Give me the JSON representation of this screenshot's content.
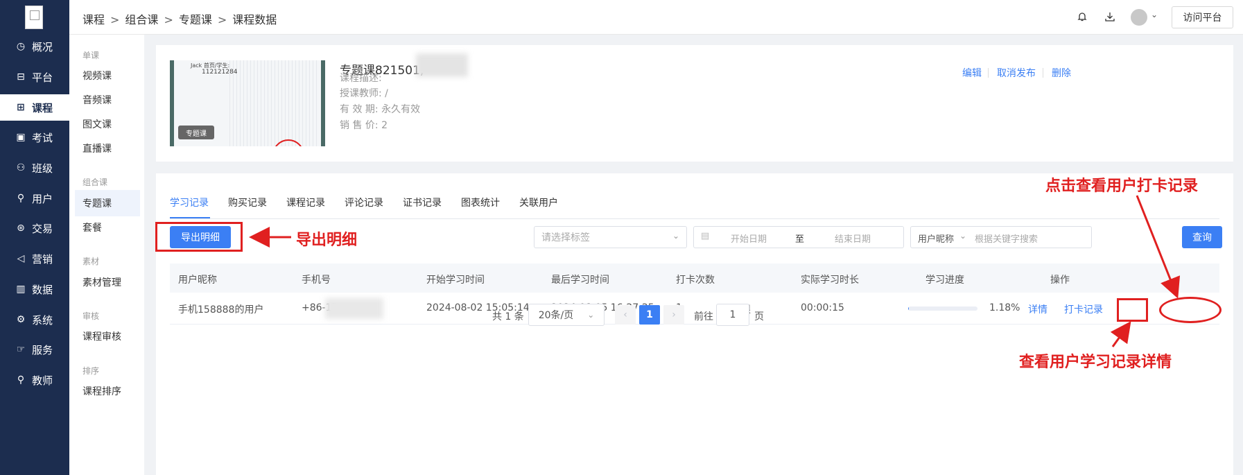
{
  "breadcrumb": [
    "课程",
    "组合课",
    "专题课",
    "课程数据"
  ],
  "header": {
    "visit_label": "访问平台"
  },
  "left_nav": [
    {
      "label": "概况",
      "icon": "◷",
      "icon_name": "overview-icon"
    },
    {
      "label": "平台",
      "icon": "⊟",
      "icon_name": "platform-icon"
    },
    {
      "label": "课程",
      "icon": "⊞",
      "icon_name": "course-icon"
    },
    {
      "label": "考试",
      "icon": "▣",
      "icon_name": "exam-icon"
    },
    {
      "label": "班级",
      "icon": "⚇",
      "icon_name": "class-icon"
    },
    {
      "label": "用户",
      "icon": "⚲",
      "icon_name": "user-icon"
    },
    {
      "label": "交易",
      "icon": "⊛",
      "icon_name": "trade-icon"
    },
    {
      "label": "营销",
      "icon": "◁",
      "icon_name": "marketing-icon"
    },
    {
      "label": "数据",
      "icon": "▥",
      "icon_name": "data-icon"
    },
    {
      "label": "系统",
      "icon": "⚙",
      "icon_name": "system-icon"
    },
    {
      "label": "服务",
      "icon": "☞",
      "icon_name": "service-icon"
    },
    {
      "label": "教师",
      "icon": "⚲",
      "icon_name": "teacher-icon"
    }
  ],
  "sub_nav": {
    "groups": [
      "单课",
      "组合课",
      "素材",
      "审核",
      "排序"
    ],
    "items": [
      "视频课",
      "音频课",
      "图文课",
      "直播课",
      "专题课",
      "套餐",
      "素材管理",
      "课程审核",
      "课程排序"
    ]
  },
  "course": {
    "title": "专题课821501,",
    "thumb_name": "Jack 首页/学生:",
    "thumb_id": "112121284",
    "badge": "专题课",
    "desc_label": "课程描述:",
    "teacher": "授课教师: /",
    "validity": "有 效 期: 永久有效",
    "price": "销 售 价: 2",
    "actions": [
      "编辑",
      "取消发布",
      "删除"
    ]
  },
  "tabs": [
    "学习记录",
    "购买记录",
    "课程记录",
    "评论记录",
    "证书记录",
    "图表统计",
    "关联用户"
  ],
  "toolbar": {
    "export_label": "导出明细",
    "tag_placeholder": "请选择标签",
    "start_date": "开始日期",
    "to": "至",
    "end_date": "结束日期",
    "user_type": "用户昵称",
    "keyword_placeholder": "根据关键字搜索",
    "search_label": "查询"
  },
  "table": {
    "headers": [
      "用户昵称",
      "手机号",
      "开始学习时间",
      "最后学习时间",
      "打卡次数",
      "实际学习时长",
      "学习进度",
      "操作"
    ],
    "row": {
      "nickname": "手机158888的用户",
      "phone": "+86-15",
      "start": "2024-08-02 15:05:14",
      "last": "2024-08-05 16:27:25",
      "checkins": "1",
      "limit": "不限",
      "duration": "00:00:15",
      "progress_text": "1.18%",
      "progress_value": 1.18,
      "op_detail": "详情",
      "op_checkin": "打卡记录"
    }
  },
  "pagination": {
    "total": "共 1 条",
    "page_size": "20条/页",
    "current": "1",
    "goto": "前往",
    "goto_value": "1",
    "page_unit": "页"
  },
  "annotations": {
    "export": "导出明细",
    "checkin": "点击查看用户打卡记录",
    "detail": "查看用户学习记录详情"
  },
  "colors": {
    "primary": "#3b7ff4",
    "nav_bg": "#1c2d4f",
    "annotation": "#e02020"
  }
}
